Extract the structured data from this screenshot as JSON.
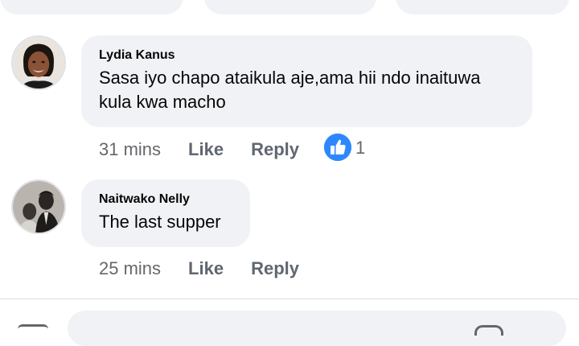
{
  "comments": [
    {
      "author": "Lydia Kanus",
      "text_line1": "Sasa iyo chapo ataikula aje,ama hii ndo inaituwa",
      "text_line2": "kula kwa macho",
      "time": "31 mins",
      "like_label": "Like",
      "reply_label": "Reply",
      "reaction_icon": "thumbs-up-icon",
      "reaction_count": "1"
    },
    {
      "author": "Naitwako Nelly",
      "text_line1": "The last supper",
      "time": "25 mins",
      "like_label": "Like",
      "reply_label": "Reply"
    }
  ],
  "colors": {
    "bubble_bg": "#f0f2f5",
    "meta_text": "#65676b",
    "like_blue": "#2d88ff"
  }
}
